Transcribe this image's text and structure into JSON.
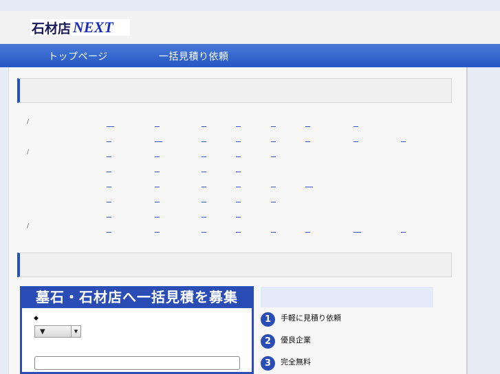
{
  "header": {
    "logo_jp": "石材店",
    "logo_en": "NEXT"
  },
  "nav": {
    "items": [
      {
        "label": "トップページ"
      },
      {
        "label": "一括見積り依頼"
      }
    ]
  },
  "list": {
    "slash": "/"
  },
  "form": {
    "title": "墓石・石材店へ一括見積を募集",
    "diamond": "◆",
    "select_value": "▼",
    "select_arrow": "▼"
  },
  "features": [
    {
      "number": "1",
      "label": "手軽に見積り依頼"
    },
    {
      "number": "2",
      "label": "優良企業"
    },
    {
      "number": "3",
      "label": "完全無料"
    }
  ],
  "colors": {
    "brand_blue": "#2a4cb5",
    "nav_blue": "#2456c4"
  }
}
